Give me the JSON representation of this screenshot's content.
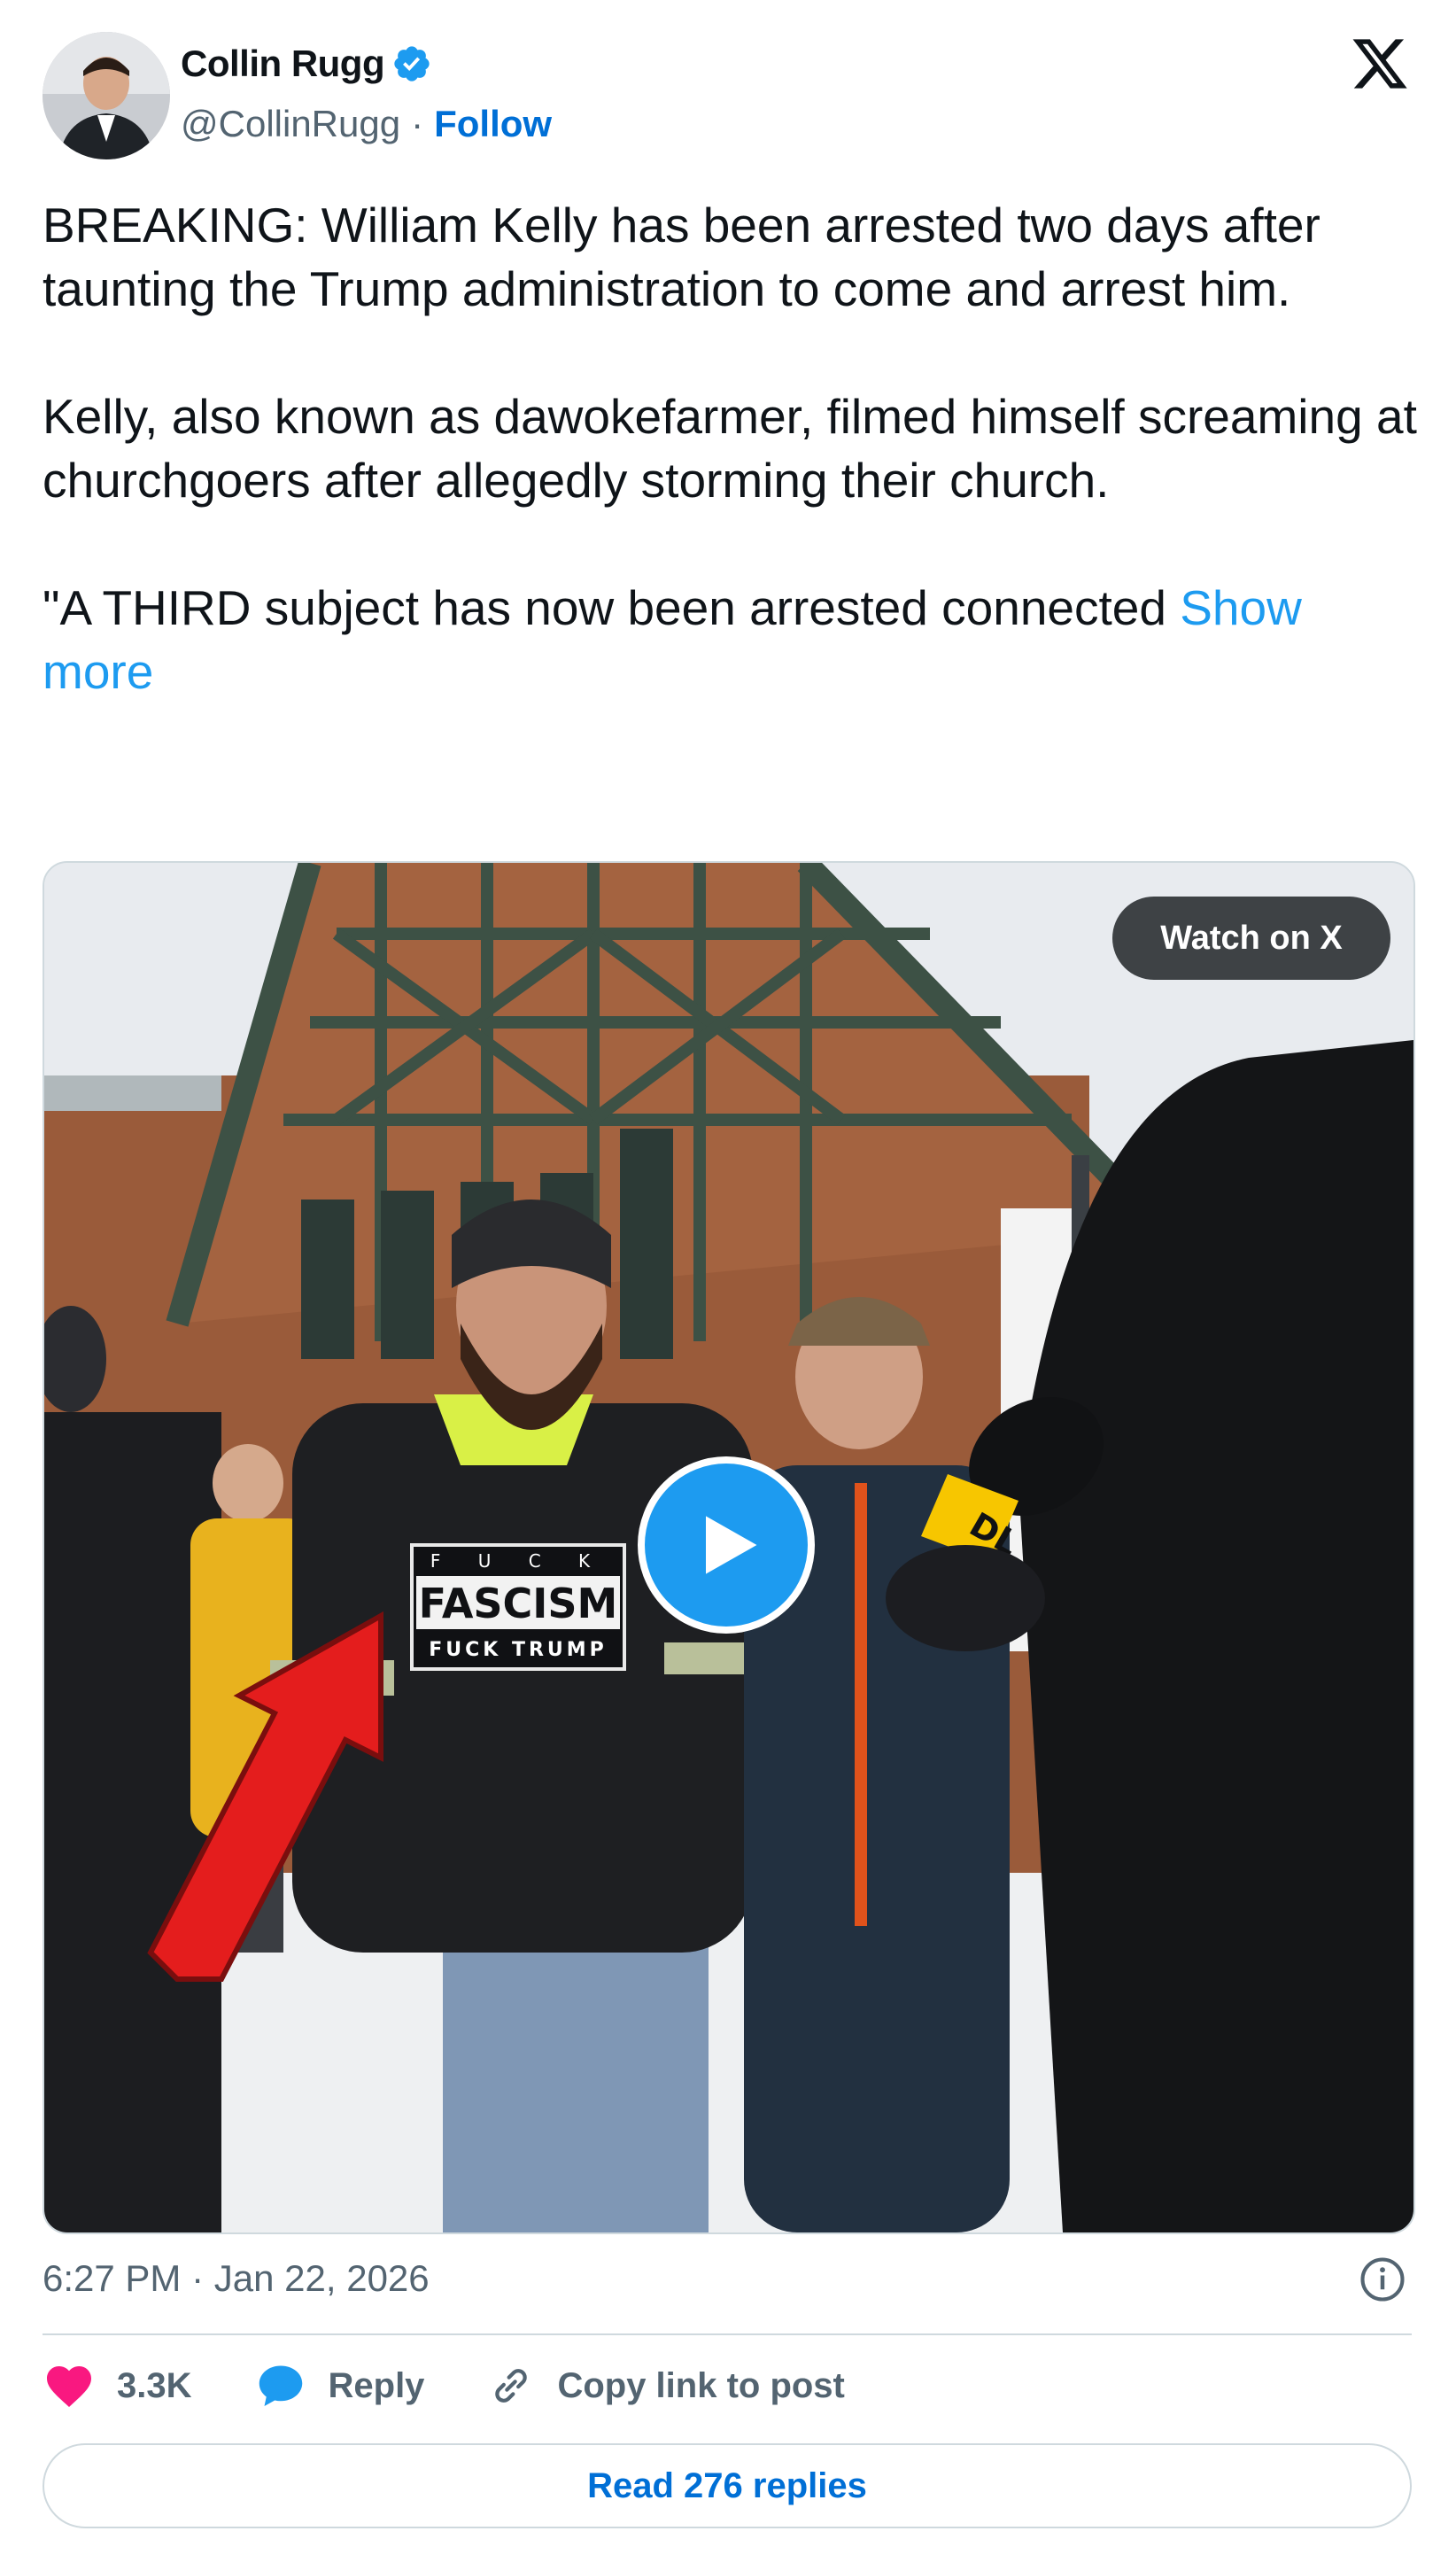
{
  "author": {
    "name": "Collin Rugg",
    "handle": "@CollinRugg",
    "separator": "·",
    "follow_label": "Follow"
  },
  "tweet": {
    "paragraphs": [
      "BREAKING: William Kelly has been arrested two days after taunting the Trump administration to come and arrest him.",
      "Kelly, also known as dawokefarmer, filmed himself screaming at churchgoers after allegedly storming their church.",
      "\"A THIRD subject has now been arrested connected"
    ],
    "show_more_label": "Show more"
  },
  "media": {
    "watch_label": "Watch on X",
    "shirt_text_top": "F U C K",
    "shirt_text_main": "FASCISM",
    "shirt_text_bottom": "FUCK TRUMP",
    "mic_text": "DL"
  },
  "meta": {
    "time": "6:27 PM",
    "separator": "·",
    "date": "Jan 22, 2026"
  },
  "actions": {
    "likes": "3.3K",
    "reply_label": "Reply",
    "copy_label": "Copy link to post",
    "read_replies_label": "Read 276 replies"
  },
  "colors": {
    "accent": "#1d9bf0",
    "link_dark": "#006fd6",
    "like_pink": "#f91880",
    "muted": "#536471",
    "border": "#cfd9de"
  },
  "icons": [
    "verified-badge-icon",
    "x-logo-icon",
    "play-icon",
    "info-icon",
    "heart-icon",
    "reply-bubble-icon",
    "link-icon"
  ]
}
